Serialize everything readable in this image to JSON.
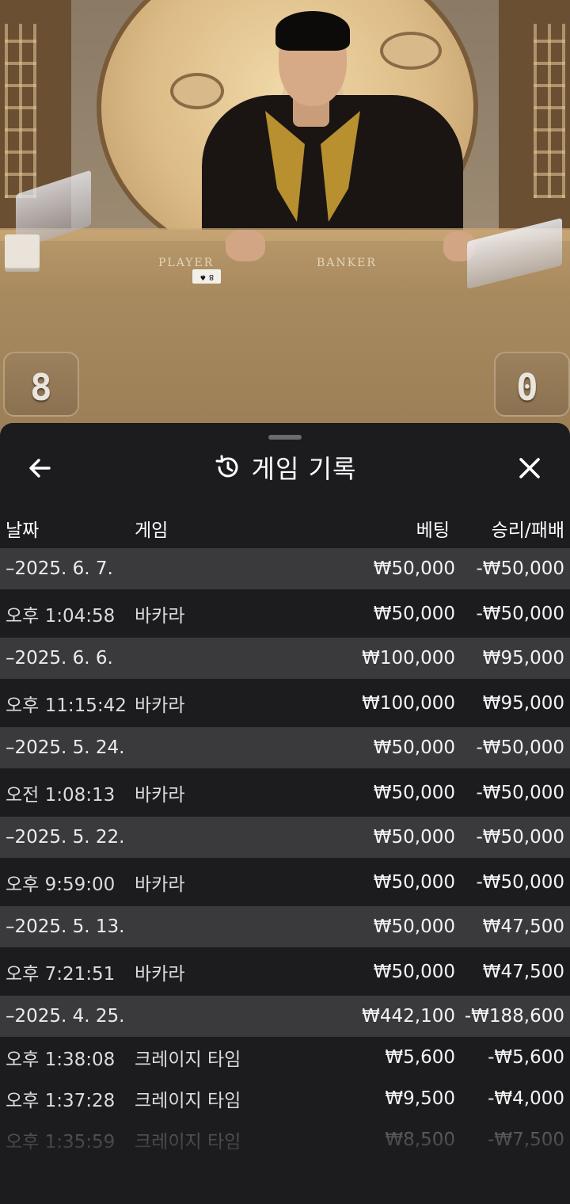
{
  "video": {
    "table_labels": {
      "player": "PLAYER",
      "banker": "BANKER"
    },
    "card_label": "8 ♠",
    "score_left": "8",
    "score_right": "0"
  },
  "header": {
    "title": "게임 기록",
    "back_icon": "arrow-left-icon",
    "history_icon": "history-icon",
    "close_icon": "close-icon"
  },
  "columns": {
    "date": "날짜",
    "game": "게임",
    "bet": "베팅",
    "win_loss": "승리/패배"
  },
  "groups": [
    {
      "date": "–2025. 6. 7.",
      "bet": "₩50,000",
      "win_loss": "-₩50,000",
      "items": [
        {
          "time": "오후 1:04:58",
          "game": "바카라",
          "bet": "₩50,000",
          "win_loss": "-₩50,000"
        }
      ]
    },
    {
      "date": "–2025. 6. 6.",
      "bet": "₩100,000",
      "win_loss": "₩95,000",
      "items": [
        {
          "time": "오후 11:15:42",
          "game": "바카라",
          "bet": "₩100,000",
          "win_loss": "₩95,000"
        }
      ]
    },
    {
      "date": "–2025. 5. 24.",
      "bet": "₩50,000",
      "win_loss": "-₩50,000",
      "items": [
        {
          "time": "오전 1:08:13",
          "game": "바카라",
          "bet": "₩50,000",
          "win_loss": "-₩50,000"
        }
      ]
    },
    {
      "date": "–2025. 5. 22.",
      "bet": "₩50,000",
      "win_loss": "-₩50,000",
      "items": [
        {
          "time": "오후 9:59:00",
          "game": "바카라",
          "bet": "₩50,000",
          "win_loss": "-₩50,000"
        }
      ]
    },
    {
      "date": "–2025. 5. 13.",
      "bet": "₩50,000",
      "win_loss": "₩47,500",
      "items": [
        {
          "time": "오후 7:21:51",
          "game": "바카라",
          "bet": "₩50,000",
          "win_loss": "₩47,500"
        }
      ]
    },
    {
      "date": "–2025. 4. 25.",
      "bet": "₩442,100",
      "win_loss": "-₩188,600",
      "items": [
        {
          "time": "오후 1:38:08",
          "game": "크레이지 타임",
          "bet": "₩5,600",
          "win_loss": "-₩5,600"
        },
        {
          "time": "오후 1:37:28",
          "game": "크레이지 타임",
          "bet": "₩9,500",
          "win_loss": "-₩4,000"
        },
        {
          "time": "오후 1:35:59",
          "game": "크레이지 타임",
          "bet": "₩8,500",
          "win_loss": "-₩7,500"
        }
      ]
    }
  ]
}
